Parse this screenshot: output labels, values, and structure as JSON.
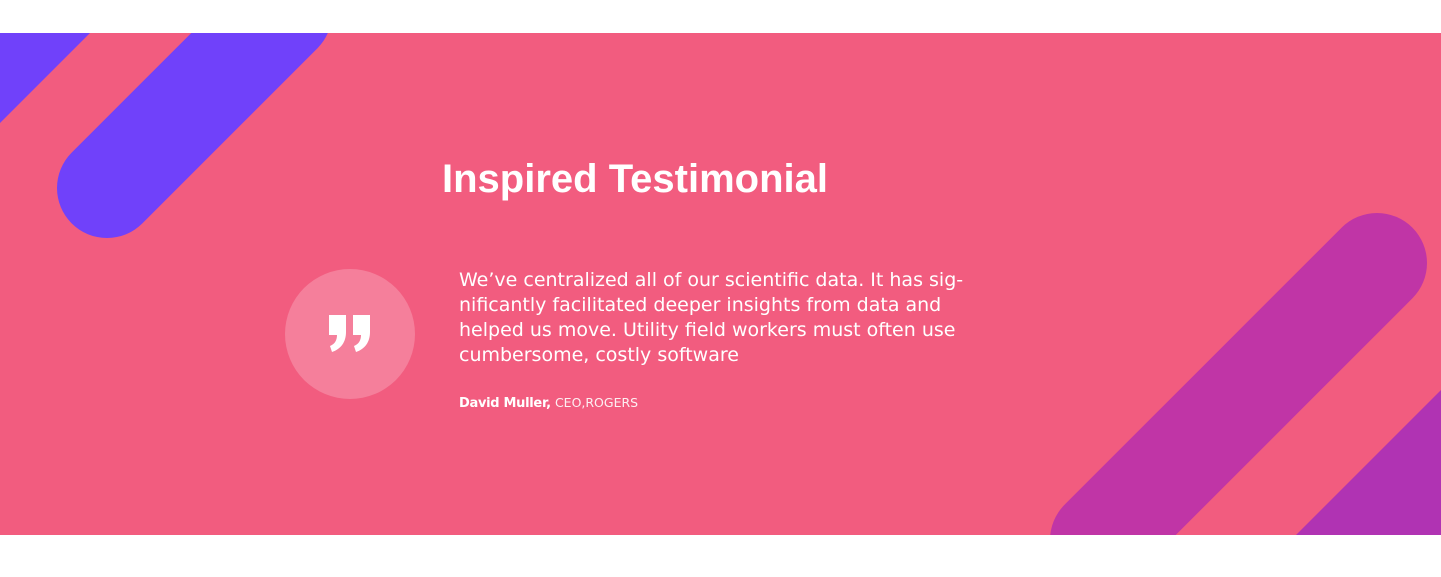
{
  "testimonial": {
    "title": "Inspired Testimonial",
    "quote_lines": [
      "We’ve centralized all of our scientific data. It has sig-",
      "nificantly facilitated deeper insights from data and",
      "helped us move. Utility field workers must often use",
      "cumbersome, costly software"
    ],
    "author_name": "David Muller,",
    "author_role": "CEO,ROGERS",
    "quote_icon": "closing-quote-icon"
  },
  "colors": {
    "background": "#f25c7f",
    "stripe_purple": "#7041fa",
    "stripe_magenta": "#c035a6",
    "text": "#ffffff"
  }
}
